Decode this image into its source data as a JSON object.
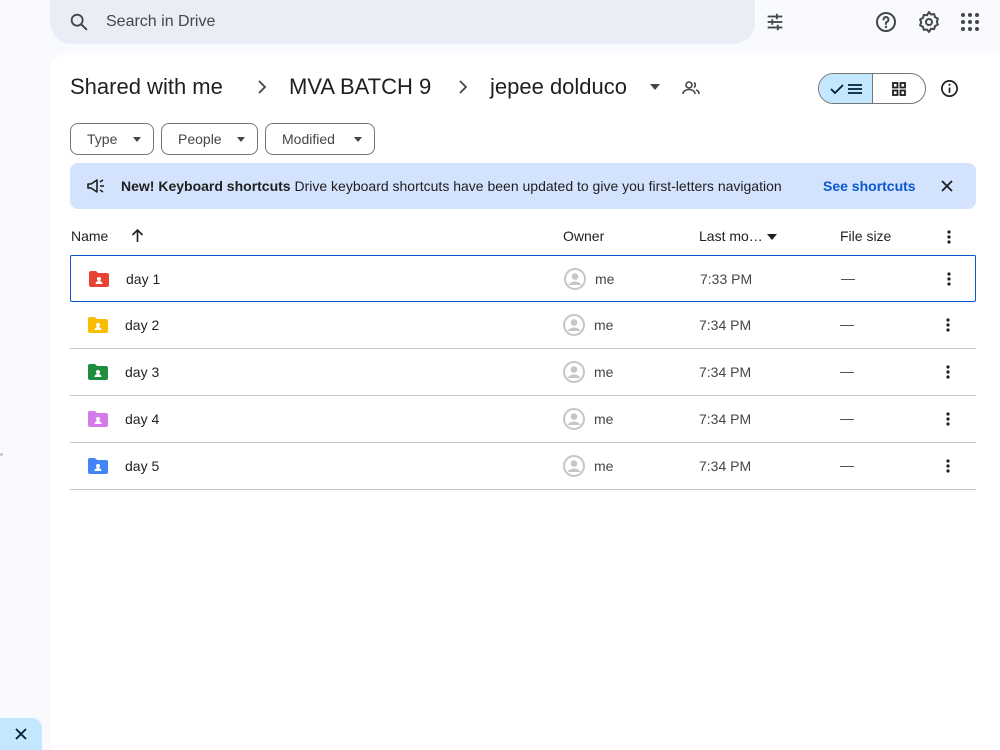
{
  "search": {
    "placeholder": "Search in Drive"
  },
  "breadcrumb": {
    "items": [
      "Shared with me",
      "MVA BATCH 9",
      "jepee dolduco"
    ]
  },
  "filters": [
    "Type",
    "People",
    "Modified"
  ],
  "banner": {
    "title": "New! Keyboard shortcuts",
    "message": "Drive keyboard shortcuts have been updated to give you first-letters navigation",
    "link": "See shortcuts"
  },
  "columns": {
    "name": "Name",
    "owner": "Owner",
    "modified": "Last mo…",
    "size": "File size"
  },
  "files": [
    {
      "name": "day 1",
      "owner": "me",
      "modified": "7:33 PM",
      "size": "—",
      "color": "#ea4335"
    },
    {
      "name": "day 2",
      "owner": "me",
      "modified": "7:34 PM",
      "size": "—",
      "color": "#fbbc04"
    },
    {
      "name": "day 3",
      "owner": "me",
      "modified": "7:34 PM",
      "size": "—",
      "color": "#1e8e3e"
    },
    {
      "name": "day 4",
      "owner": "me",
      "modified": "7:34 PM",
      "size": "—",
      "color": "#d27be9"
    },
    {
      "name": "day 5",
      "owner": "me",
      "modified": "7:34 PM",
      "size": "—",
      "color": "#4285f4"
    }
  ],
  "colors": {
    "accent": "#0b57d0",
    "banner_bg": "#d3e3fd",
    "selected_toggle": "#c2e7ff"
  }
}
